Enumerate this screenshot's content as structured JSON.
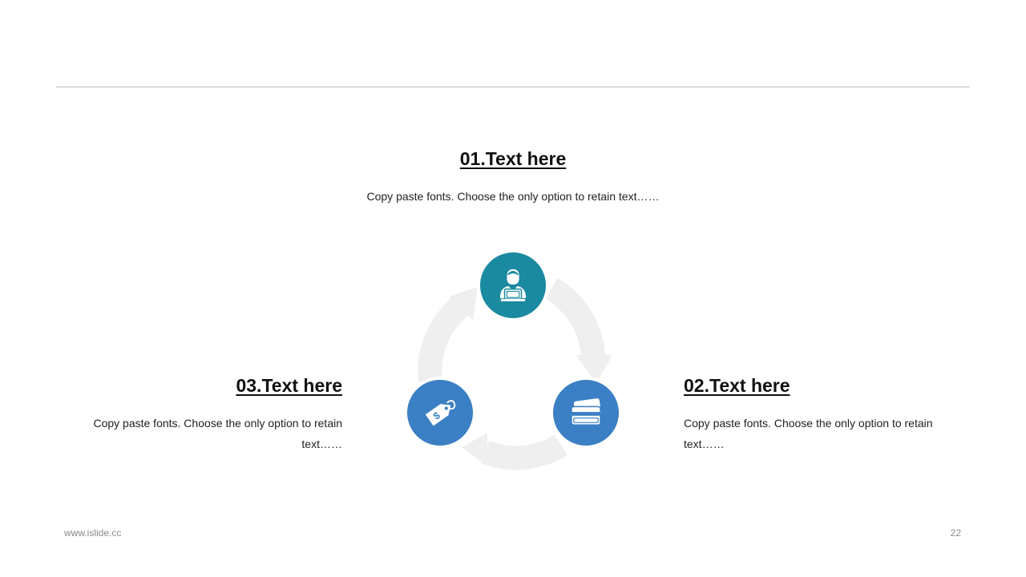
{
  "items": [
    {
      "heading": "01.Text here",
      "body": "Copy paste fonts. Choose the only option to retain text……",
      "icon": "user-laptop-icon",
      "color": "#1a8aa0"
    },
    {
      "heading": "02.Text here",
      "body": "Copy paste fonts. Choose the only option to retain text……",
      "icon": "credit-card-icon",
      "color": "#3b7fc4"
    },
    {
      "heading": "03.Text here",
      "body": "Copy paste fonts. Choose the only option to retain text……",
      "icon": "price-tag-icon",
      "color": "#3b7fc4"
    }
  ],
  "footer": {
    "website": "www.islide.cc",
    "page_number": "22"
  },
  "colors": {
    "teal": "#1a8aa0",
    "blue": "#3b7fc4",
    "arrow": "#efefef",
    "rule": "#bdbdbd"
  }
}
